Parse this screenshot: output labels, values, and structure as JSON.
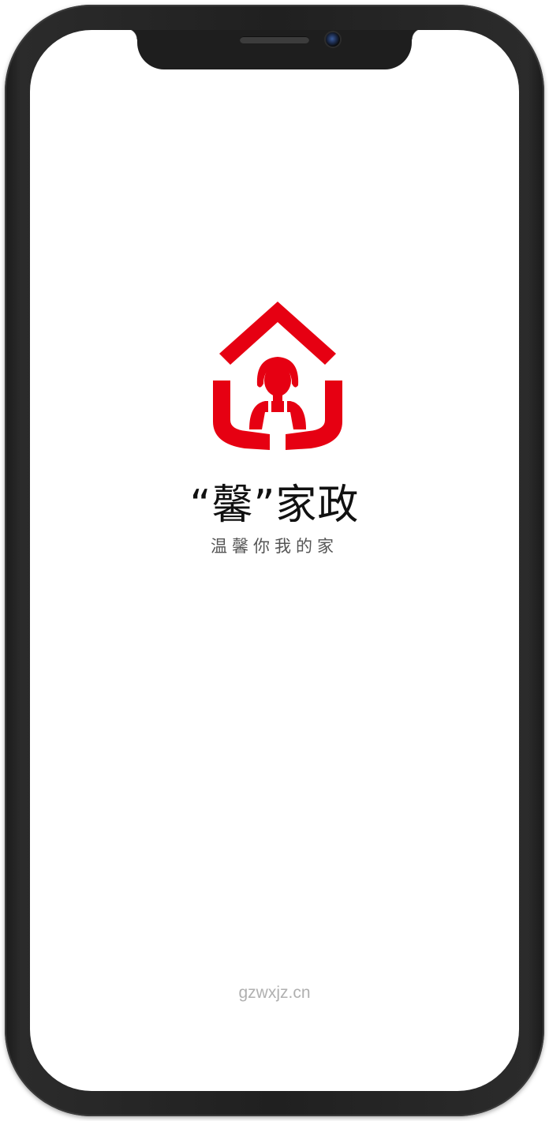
{
  "splash": {
    "brand_title": "“馨”家政",
    "slogan": "温馨你我的家",
    "site_url": "gzwxjz.cn"
  },
  "colors": {
    "brand_red": "#e60012",
    "device_frame": "#202020",
    "screen_background": "#ffffff",
    "title_text": "#111111",
    "slogan_text": "#555555",
    "url_text": "#b0b0b0"
  },
  "icons": {
    "logo": "house-with-housekeeper-icon",
    "camera": "front-camera-icon",
    "speaker": "earpiece-speaker-icon"
  }
}
